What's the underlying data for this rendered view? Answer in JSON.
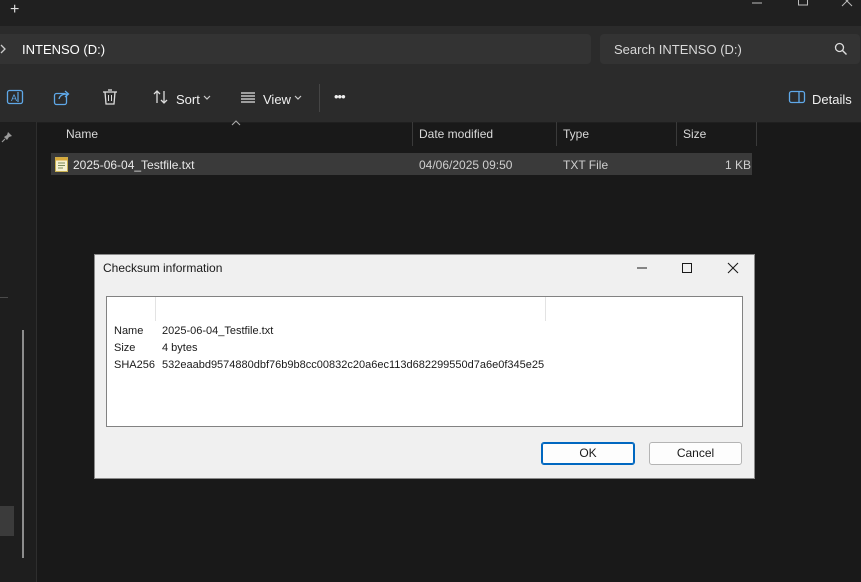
{
  "window": {
    "new_tab": "+"
  },
  "address": {
    "path": "INTENSO (D:)"
  },
  "search": {
    "placeholder": "Search INTENSO (D:)"
  },
  "toolbar": {
    "sort_label": "Sort",
    "view_label": "View",
    "more_label": "•••",
    "details_label": "Details"
  },
  "columns": {
    "name": "Name",
    "date": "Date modified",
    "type": "Type",
    "size": "Size"
  },
  "files": [
    {
      "name": "2025-06-04_Testfile.txt",
      "date": "04/06/2025 09:50",
      "type": "TXT File",
      "size": "1 KB"
    }
  ],
  "dialog": {
    "title": "Checksum information",
    "rows": [
      {
        "key": "Name",
        "value": "2025-06-04_Testfile.txt"
      },
      {
        "key": "Size",
        "value": "4 bytes"
      },
      {
        "key": "SHA256",
        "value": "532eaabd9574880dbf76b9b8cc00832c20a6ec113d682299550d7a6e0f345e25"
      }
    ],
    "ok_label": "OK",
    "cancel_label": "Cancel"
  },
  "colors": {
    "accent": "#0067c0",
    "background": "#191919",
    "dialog_bg": "#f0f0f0"
  }
}
